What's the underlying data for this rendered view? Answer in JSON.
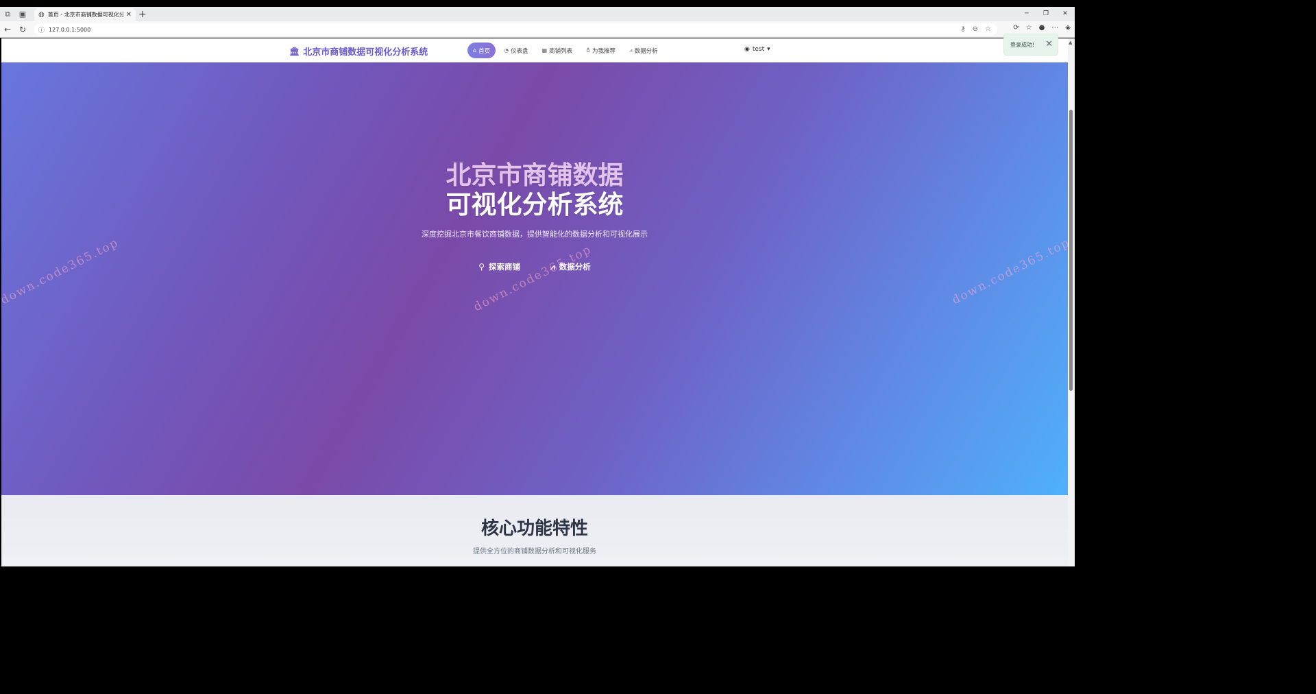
{
  "browser": {
    "tab_title": "首页 - 北京市商铺数据可视化分析",
    "url": "127.0.0.1:5000"
  },
  "site": {
    "brand": "北京市商铺数据可视化分析系统",
    "nav": [
      {
        "label": "首页",
        "icon": "home-icon",
        "active": true
      },
      {
        "label": "仪表盘",
        "icon": "dashboard-icon",
        "active": false
      },
      {
        "label": "商铺列表",
        "icon": "store-icon",
        "active": false
      },
      {
        "label": "为我推荐",
        "icon": "lightbulb-icon",
        "active": false
      },
      {
        "label": "数据分析",
        "icon": "chart-icon",
        "active": false
      }
    ],
    "user": "test"
  },
  "hero": {
    "title_line1": "北京市商铺数据",
    "title_line2": "可视化分析系统",
    "subtitle": "深度挖掘北京市餐饮商铺数据，提供智能化的数据分析和可视化展示",
    "buttons": [
      {
        "label": "探索商铺",
        "icon": "search-icon"
      },
      {
        "label": "数据分析",
        "icon": "chart-icon"
      }
    ]
  },
  "toast": {
    "message": "登录成功!"
  },
  "watermark": "down.code365.top",
  "features": {
    "title": "核心功能特性",
    "subtitle": "提供全方位的商铺数据分析和可视化服务"
  }
}
